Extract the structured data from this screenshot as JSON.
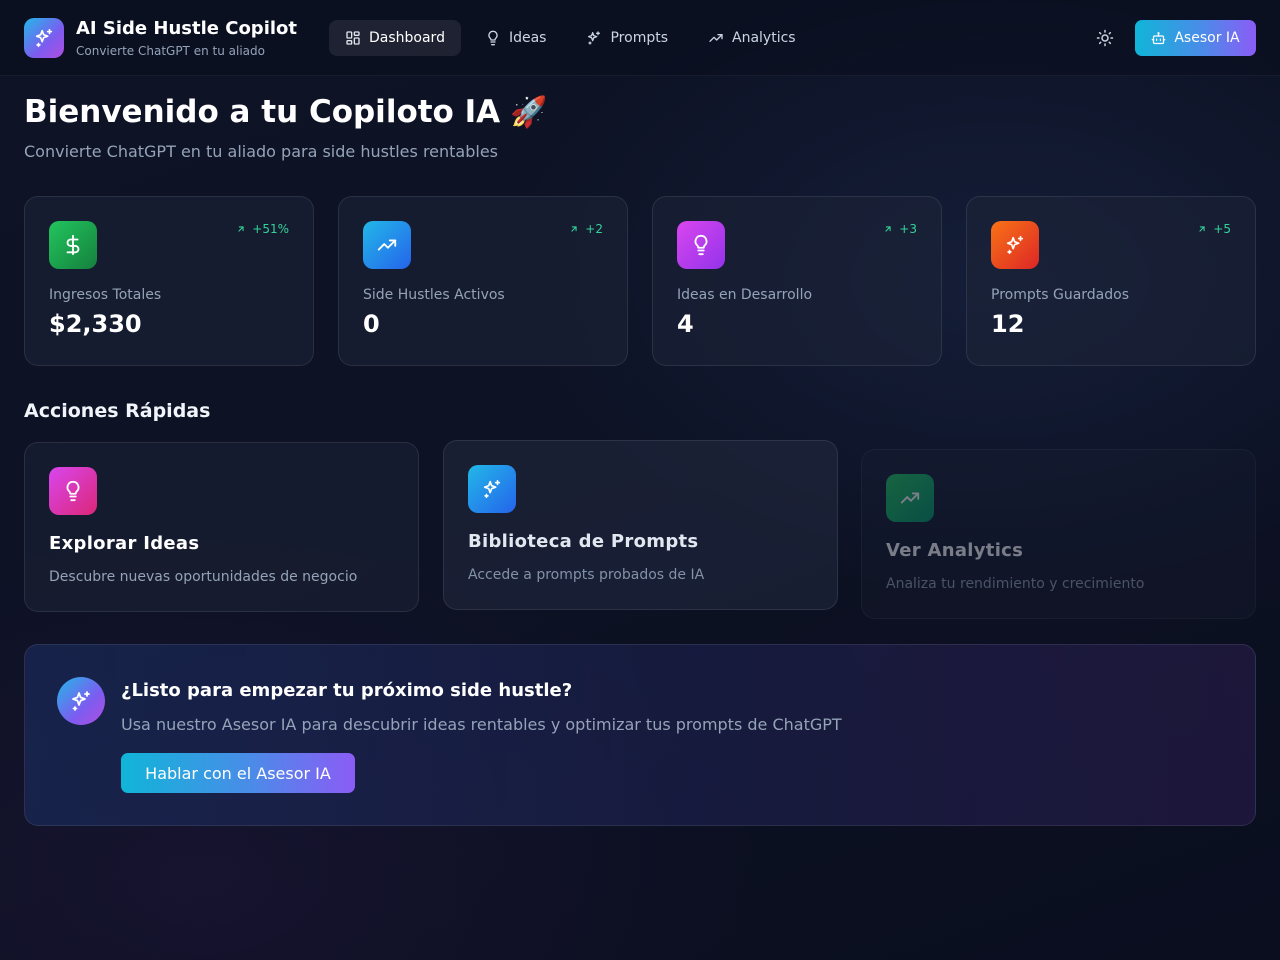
{
  "header": {
    "brand_title": "AI Side Hustle Copilot",
    "brand_subtitle": "Convierte ChatGPT en tu aliado",
    "logo_icon": "sparkles-icon",
    "nav": [
      {
        "label": "Dashboard",
        "icon": "layout-grid-icon",
        "active": true
      },
      {
        "label": "Ideas",
        "icon": "lightbulb-icon",
        "active": false
      },
      {
        "label": "Prompts",
        "icon": "sparkles-icon",
        "active": false
      },
      {
        "label": "Analytics",
        "icon": "trending-up-icon",
        "active": false
      }
    ],
    "theme_toggle_icon": "sun-icon",
    "advisor_button": {
      "label": "Asesor IA",
      "icon": "bot-icon"
    }
  },
  "page": {
    "title": "Bienvenido a tu Copiloto IA",
    "title_emoji": "🚀",
    "subtitle": "Convierte ChatGPT en tu aliado para side hustles rentables"
  },
  "stats": [
    {
      "label": "Ingresos Totales",
      "value": "$2,330",
      "change": "+51%",
      "icon": "dollar-icon",
      "color": "#16a34a"
    },
    {
      "label": "Side Hustles Activos",
      "value": "0",
      "change": "+2",
      "icon": "trending-up-icon",
      "color": "#0ea5e9"
    },
    {
      "label": "Ideas en Desarrollo",
      "value": "4",
      "change": "+3",
      "icon": "lightbulb-icon",
      "color": "#c026d3"
    },
    {
      "label": "Prompts Guardados",
      "value": "12",
      "change": "+5",
      "icon": "sparkles-icon",
      "color": "#ea580c"
    }
  ],
  "quick_actions": {
    "title": "Acciones Rápidas",
    "items": [
      {
        "title": "Explorar Ideas",
        "description": "Descubre nuevas oportunidades de negocio",
        "icon": "lightbulb-icon"
      },
      {
        "title": "Biblioteca de Prompts",
        "description": "Accede a prompts probados de IA",
        "icon": "sparkles-icon"
      },
      {
        "title": "Ver Analytics",
        "description": "Analiza tu rendimiento y crecimiento",
        "icon": "trending-up-icon"
      }
    ]
  },
  "cta": {
    "title": "¿Listo para empezar tu próximo side hustle?",
    "description": "Usa nuestro Asesor IA para descubrir ideas rentables y optimizar tus prompts de ChatGPT",
    "button": "Hablar con el Asesor IA",
    "icon": "sparkles-icon"
  },
  "colors": {
    "accent_cyan": "#10b5d8",
    "accent_purple": "#8b5cf6",
    "positive": "#34d399",
    "background": "#0d1224"
  }
}
